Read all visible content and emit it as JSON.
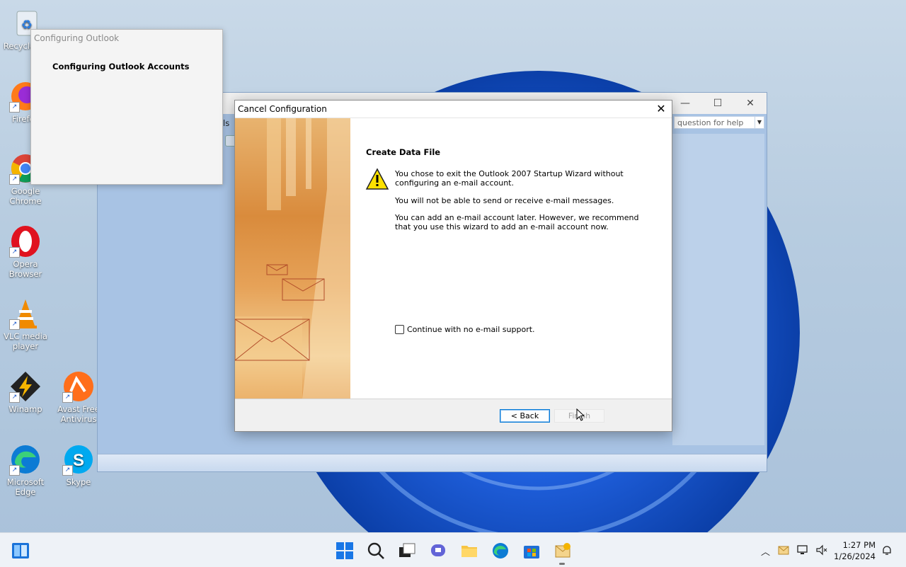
{
  "desktop": {
    "icons": [
      {
        "label": "Recycle Bin"
      },
      {
        "label": "Firefox"
      },
      {
        "label": "Google Chrome"
      },
      {
        "label": "Opera Browser"
      },
      {
        "label": "VLC media player"
      },
      {
        "label": "Winamp"
      },
      {
        "label": "Avast Free Antivirus"
      },
      {
        "label": "Microsoft Edge"
      },
      {
        "label": "Skype"
      }
    ]
  },
  "main_window": {
    "menu_text": "ols",
    "help_placeholder": "question for help"
  },
  "config_window": {
    "title": "Configuring Outlook",
    "heading": "Configuring Outlook Accounts"
  },
  "dialog": {
    "title": "Cancel Configuration",
    "heading": "Create Data File",
    "line1": "You chose to exit the Outlook 2007 Startup Wizard without configuring an e-mail account.",
    "line2": "You will not be able to send or receive e-mail messages.",
    "line3": "You can add an e-mail account later. However, we recommend that you use this wizard to add an e-mail account now.",
    "checkbox_label": "Continue with no e-mail support.",
    "back_label": "< Back",
    "finish_label": "Finish"
  },
  "taskbar": {
    "time": "1:27 PM",
    "date": "1/26/2024"
  },
  "colors": {
    "accent": "#0078d7",
    "wallpaper_bloom": "#1e5bd6"
  }
}
